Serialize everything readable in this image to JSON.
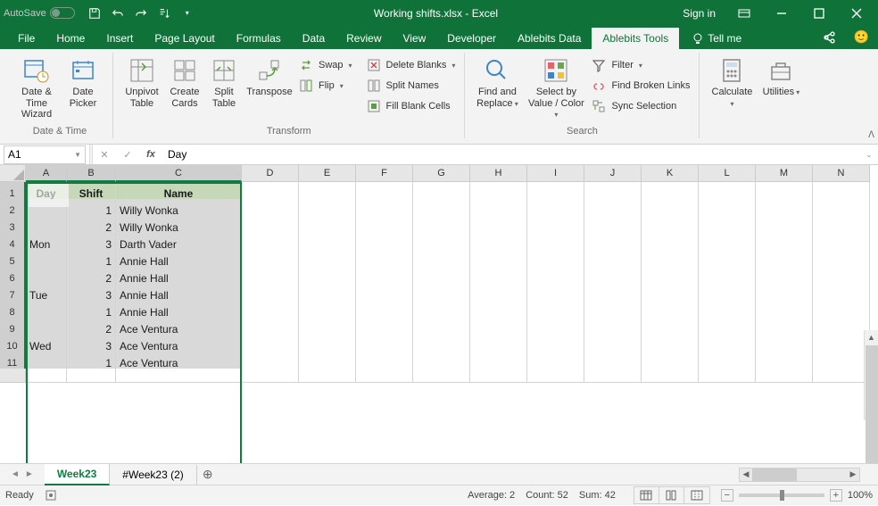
{
  "titlebar": {
    "autosave_label": "AutoSave",
    "autosave_state": "Off",
    "file_title": "Working shifts.xlsx  -  Excel",
    "signin_label": "Sign in"
  },
  "tabs": [
    "File",
    "Home",
    "Insert",
    "Page Layout",
    "Formulas",
    "Data",
    "Review",
    "View",
    "Developer",
    "Ablebits Data",
    "Ablebits Tools"
  ],
  "active_tab": "Ablebits Tools",
  "tellme_label": "Tell me",
  "ribbon": {
    "datetime": {
      "date_time_wizard": "Date &\nTime Wizard",
      "date_picker": "Date\nPicker",
      "group": "Date & Time"
    },
    "transform": {
      "unpivot": "Unpivot\nTable",
      "create_cards": "Create\nCards",
      "split_table": "Split\nTable",
      "transpose": "Transpose",
      "swap": "Swap",
      "flip": "Flip",
      "delete_blanks": "Delete Blanks",
      "split_names": "Split Names",
      "fill_blank": "Fill Blank Cells",
      "group": "Transform"
    },
    "search": {
      "find_replace": "Find and\nReplace",
      "select_by": "Select by\nValue / Color",
      "filter": "Filter",
      "find_links": "Find Broken Links",
      "sync_sel": "Sync Selection",
      "group": "Search"
    },
    "calculate": "Calculate",
    "utilities": "Utilities"
  },
  "namebox": "A1",
  "formula": "Day",
  "columns": [
    "A",
    "B",
    "C",
    "D",
    "E",
    "F",
    "G",
    "H",
    "I",
    "J",
    "K",
    "L",
    "M",
    "N"
  ],
  "rows": {
    "header": [
      "Day",
      "Shift",
      "Name"
    ],
    "data": [
      [
        "",
        "1",
        "Willy Wonka"
      ],
      [
        "",
        "2",
        "Willy Wonka"
      ],
      [
        "Mon",
        "3",
        "Darth Vader"
      ],
      [
        "",
        "1",
        "Annie Hall"
      ],
      [
        "",
        "2",
        "Annie Hall"
      ],
      [
        "Tue",
        "3",
        "Annie Hall"
      ],
      [
        "",
        "1",
        "Annie Hall"
      ],
      [
        "",
        "2",
        "Ace Ventura"
      ],
      [
        "Wed",
        "3",
        "Ace Ventura"
      ],
      [
        "",
        "1",
        "Ace Ventura"
      ]
    ]
  },
  "sheets": {
    "active": "Week23",
    "others": [
      "#Week23 (2)"
    ]
  },
  "status": {
    "ready": "Ready",
    "average": "Average: 2",
    "count": "Count: 52",
    "sum": "Sum: 42",
    "zoom": "100%"
  }
}
